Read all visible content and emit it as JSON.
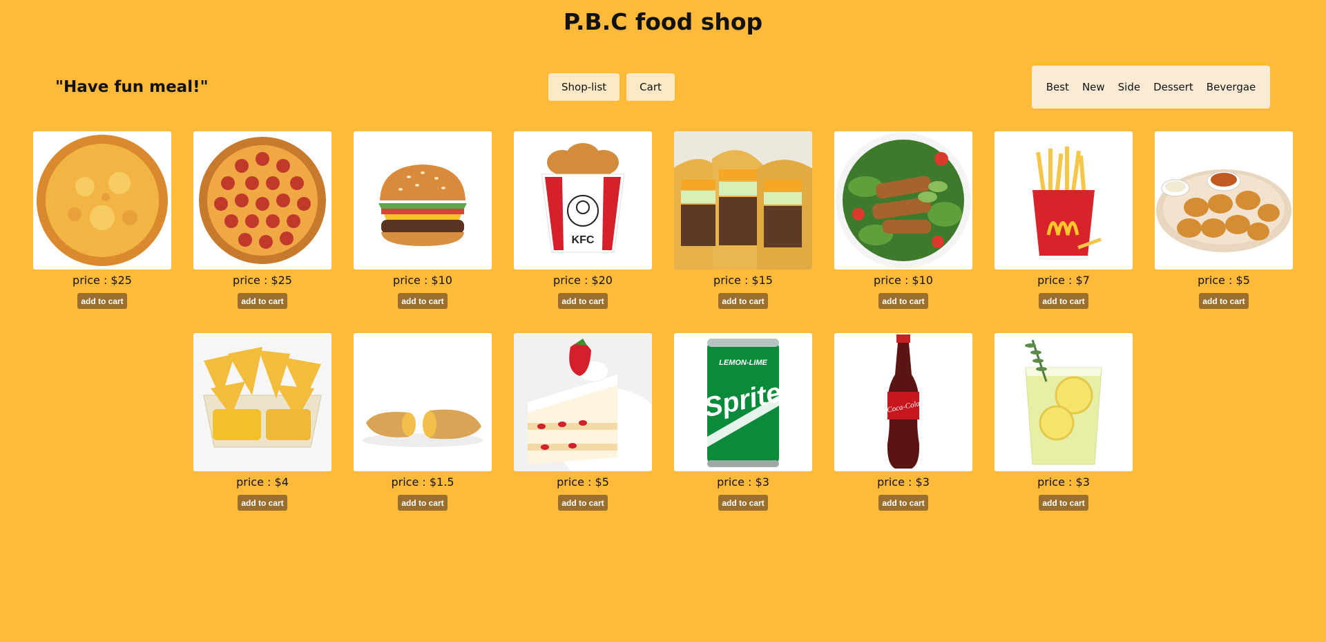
{
  "header": {
    "title": "P.B.C food shop",
    "tagline": "\"Have fun meal!\""
  },
  "nav": {
    "shop_list": "Shop-list",
    "cart": "Cart"
  },
  "categories": [
    "Best",
    "New",
    "Side",
    "Dessert",
    "Bevergae"
  ],
  "colors": {
    "background": "#FFBA3A",
    "nav_button": "#FDE9C6",
    "category_menu": "#FCEBD4",
    "add_button": "#9A6F2D"
  },
  "add_label": "add to cart",
  "products": [
    {
      "image": "cheese-pizza",
      "price": "price : $25"
    },
    {
      "image": "pepperoni-pizza",
      "price": "price : $25"
    },
    {
      "image": "burger",
      "price": "price : $10"
    },
    {
      "image": "chicken-bucket",
      "price": "price : $20"
    },
    {
      "image": "tacos",
      "price": "price : $15"
    },
    {
      "image": "chicken-salad",
      "price": "price : $10"
    },
    {
      "image": "french-fries",
      "price": "price : $7"
    },
    {
      "image": "chicken-nuggets",
      "price": "price : $5"
    },
    {
      "image": "nachos",
      "price": "price : $4"
    },
    {
      "image": "apple-pie",
      "price": "price : $1.5"
    },
    {
      "image": "strawberry-cake",
      "price": "price : $5"
    },
    {
      "image": "sprite-can",
      "price": "price : $3"
    },
    {
      "image": "coca-cola-bottle",
      "price": "price : $3"
    },
    {
      "image": "lemonade",
      "price": "price : $3"
    }
  ],
  "image_texts": {
    "kfc": "KFC",
    "sprite_top": "LEMON-LIME",
    "sprite_brand": "Sprite",
    "coke_brand": "Coca-Cola"
  }
}
